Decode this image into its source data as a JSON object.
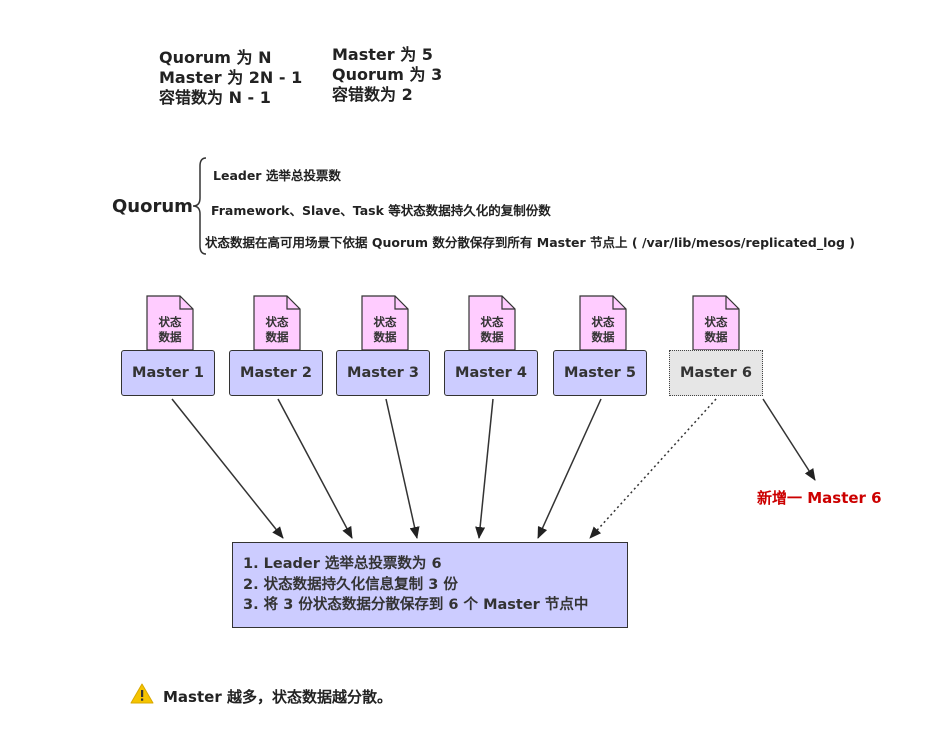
{
  "formulas": {
    "general": [
      "Quorum 为 N",
      "Master 为 2N - 1",
      "容错数为 N - 1"
    ],
    "example": [
      "Master 为 5",
      "Quorum 为 3",
      "容错数为 2"
    ]
  },
  "quorum": {
    "label": "Quorum",
    "items": [
      "Leader 选举总投票数",
      "Framework、Slave、Task 等状态数据持久化的复制份数",
      "状态数据在高可用场景下依据 Quorum 数分散保存到所有 Master 节点上 ( /var/lib/mesos/replicated_log )"
    ]
  },
  "state_doc": {
    "line1": "状态",
    "line2": "数据"
  },
  "masters": [
    "Master 1",
    "Master 2",
    "Master 3",
    "Master 4",
    "Master 5",
    "Master 6"
  ],
  "new_master_label": "新增一 Master 6",
  "summary": [
    "1. Leader 选举总投票数为 6",
    "2. 状态数据持久化信息复制 3 份",
    "3. 将 3 份状态数据分散保存到 6 个 Master 节点中"
  ],
  "note": {
    "icon": "warning-icon",
    "text": "Master 越多，状态数据越分散。"
  },
  "colors": {
    "master_fill": "#ccccff",
    "new_master_fill": "#e6e6e6",
    "doc_fill": "#ffccff",
    "highlight_text": "#cc0000",
    "warning": "#f5c400"
  }
}
